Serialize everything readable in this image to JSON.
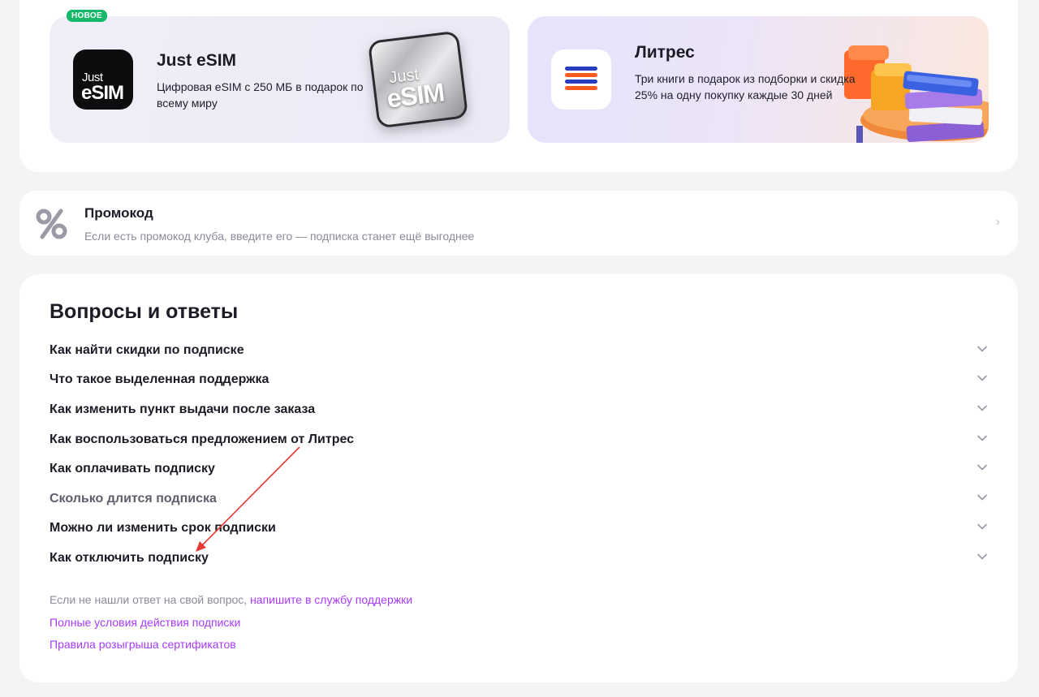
{
  "partners": {
    "esim": {
      "badge": "НОВОЕ",
      "title": "Just eSIM",
      "description": "Цифровая eSIM с 250 МБ в подарок по всему миру",
      "icon_line1": "Just",
      "icon_line2": "eSIM",
      "chip_line1": "Just",
      "chip_line2": "eSIM"
    },
    "litres": {
      "title": "Литрес",
      "description": "Три книги в подарок из подборки и скидка 25% на одну покупку каждые 30 дней"
    }
  },
  "promo": {
    "title": "Промокод",
    "description": "Если есть промокод клуба, введите его — подписка станет ещё выгоднее"
  },
  "faq": {
    "title": "Вопросы и ответы",
    "items": [
      "Как найти скидки по подписке",
      "Что такое выделенная поддержка",
      "Как изменить пункт выдачи после заказа",
      "Как воспользоваться предложением от Литрес",
      "Как оплачивать подписку",
      "Сколько длится подписка",
      "Можно ли изменить срок подписки",
      "Как отключить подписку"
    ],
    "footer_text": "Если не нашли ответ на свой вопрос, ",
    "support_link": "напишите в службу поддержки",
    "terms_link": "Полные условия действия подписки",
    "rules_link": "Правила розыгрыша сертификатов"
  },
  "colors": {
    "link": "#a73afd",
    "badge": "#16b86a",
    "annotation_arrow": "#e53935",
    "litres_bar_blue": "#2a3fbf",
    "litres_bar_orange": "#ff5a1f"
  }
}
